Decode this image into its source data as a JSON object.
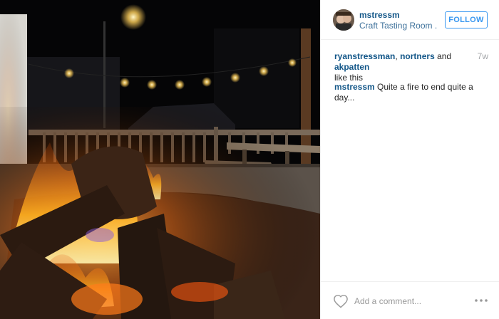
{
  "post": {
    "username": "mstressm",
    "location": "Craft Tasting Room ...",
    "follow_label": "FOLLOW",
    "likes": {
      "users": [
        "ryanstressman",
        "nortners",
        "akpatten"
      ],
      "separator": ", ",
      "and": " and ",
      "suffix": "like this"
    },
    "time_ago": "7w",
    "caption": {
      "username": "mstressm",
      "text": "Quite a fire to end quite a day..."
    },
    "comment_placeholder": "Add a comment...",
    "more_icon": "ellipsis-icon",
    "like_icon": "heart-icon"
  },
  "colors": {
    "link": "#125688",
    "location": "#3f729b",
    "follow": "#3897f0",
    "muted": "#a5a7aa"
  }
}
